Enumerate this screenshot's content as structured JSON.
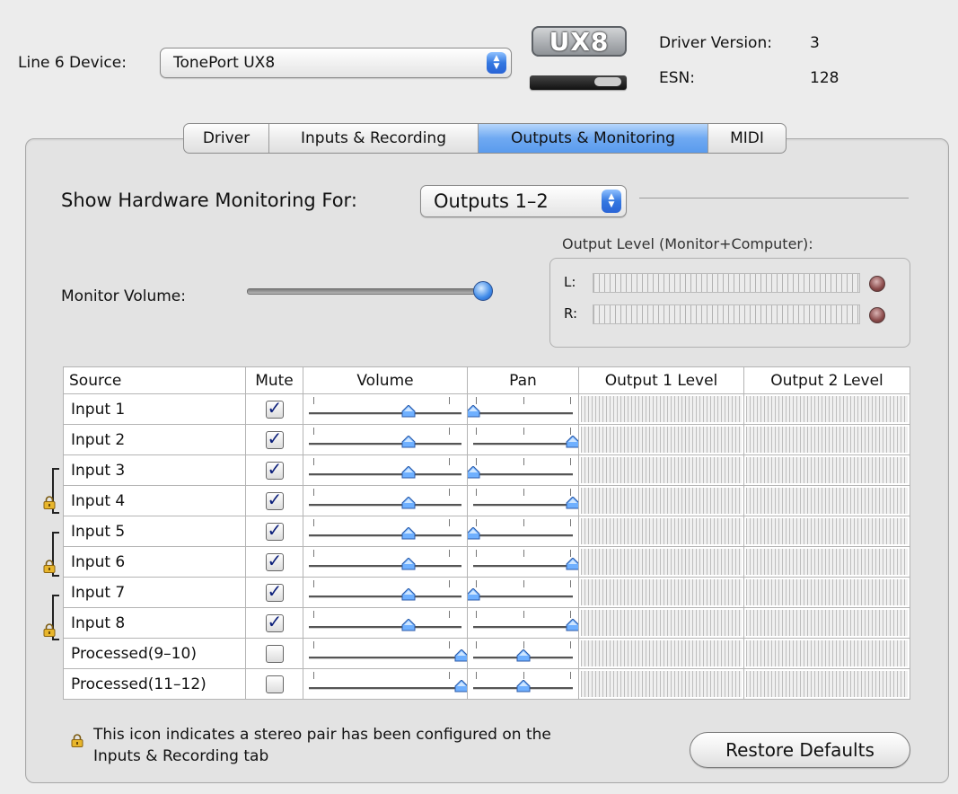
{
  "header": {
    "device_label": "Line 6 Device:",
    "device_value": "TonePort UX8",
    "logo_text": "UX8",
    "driver_version_label": "Driver Version:",
    "driver_version_value": "3",
    "esn_label": "ESN:",
    "esn_value": "128"
  },
  "tabs": [
    {
      "label": "Driver",
      "active": false
    },
    {
      "label": "Inputs & Recording",
      "active": false
    },
    {
      "label": "Outputs & Monitoring",
      "active": true
    },
    {
      "label": "MIDI",
      "active": false
    }
  ],
  "monitoring": {
    "show_for_label": "Show Hardware Monitoring For:",
    "show_for_value": "Outputs 1–2",
    "monitor_volume_label": "Monitor Volume:",
    "monitor_volume_level": 1.0,
    "output_level_label": "Output Level (Monitor+Computer):",
    "left_label": "L:",
    "right_label": "R:"
  },
  "table": {
    "headers": [
      "Source",
      "Mute",
      "Volume",
      "Pan",
      "Output 1 Level",
      "Output 2 Level"
    ],
    "rows": [
      {
        "source": "Input 1",
        "mute": true,
        "volume": 0.65,
        "pan": 0.0,
        "lock": false
      },
      {
        "source": "Input 2",
        "mute": true,
        "volume": 0.65,
        "pan": 1.0,
        "lock": false
      },
      {
        "source": "Input 3",
        "mute": true,
        "volume": 0.65,
        "pan": 0.0,
        "lock": false
      },
      {
        "source": "Input 4",
        "mute": true,
        "volume": 0.65,
        "pan": 1.0,
        "lock": true
      },
      {
        "source": "Input 5",
        "mute": true,
        "volume": 0.65,
        "pan": 0.0,
        "lock": false
      },
      {
        "source": "Input 6",
        "mute": true,
        "volume": 0.65,
        "pan": 1.0,
        "lock": true
      },
      {
        "source": "Input 7",
        "mute": true,
        "volume": 0.65,
        "pan": 0.0,
        "lock": false
      },
      {
        "source": "Input 8",
        "mute": true,
        "volume": 0.65,
        "pan": 1.0,
        "lock": true
      },
      {
        "source": "Processed(9–10)",
        "mute": false,
        "volume": 1.0,
        "pan": 0.5,
        "lock": false
      },
      {
        "source": "Processed(11–12)",
        "mute": false,
        "volume": 1.0,
        "pan": 0.5,
        "lock": false
      }
    ]
  },
  "footer": {
    "note_line1": "This icon indicates a stereo pair has been configured on the",
    "note_line2": "Inputs & Recording tab",
    "restore_button": "Restore Defaults"
  },
  "colors": {
    "accent": "#5a9bed",
    "knob": "#3f8ae8",
    "background": "#ececec"
  }
}
